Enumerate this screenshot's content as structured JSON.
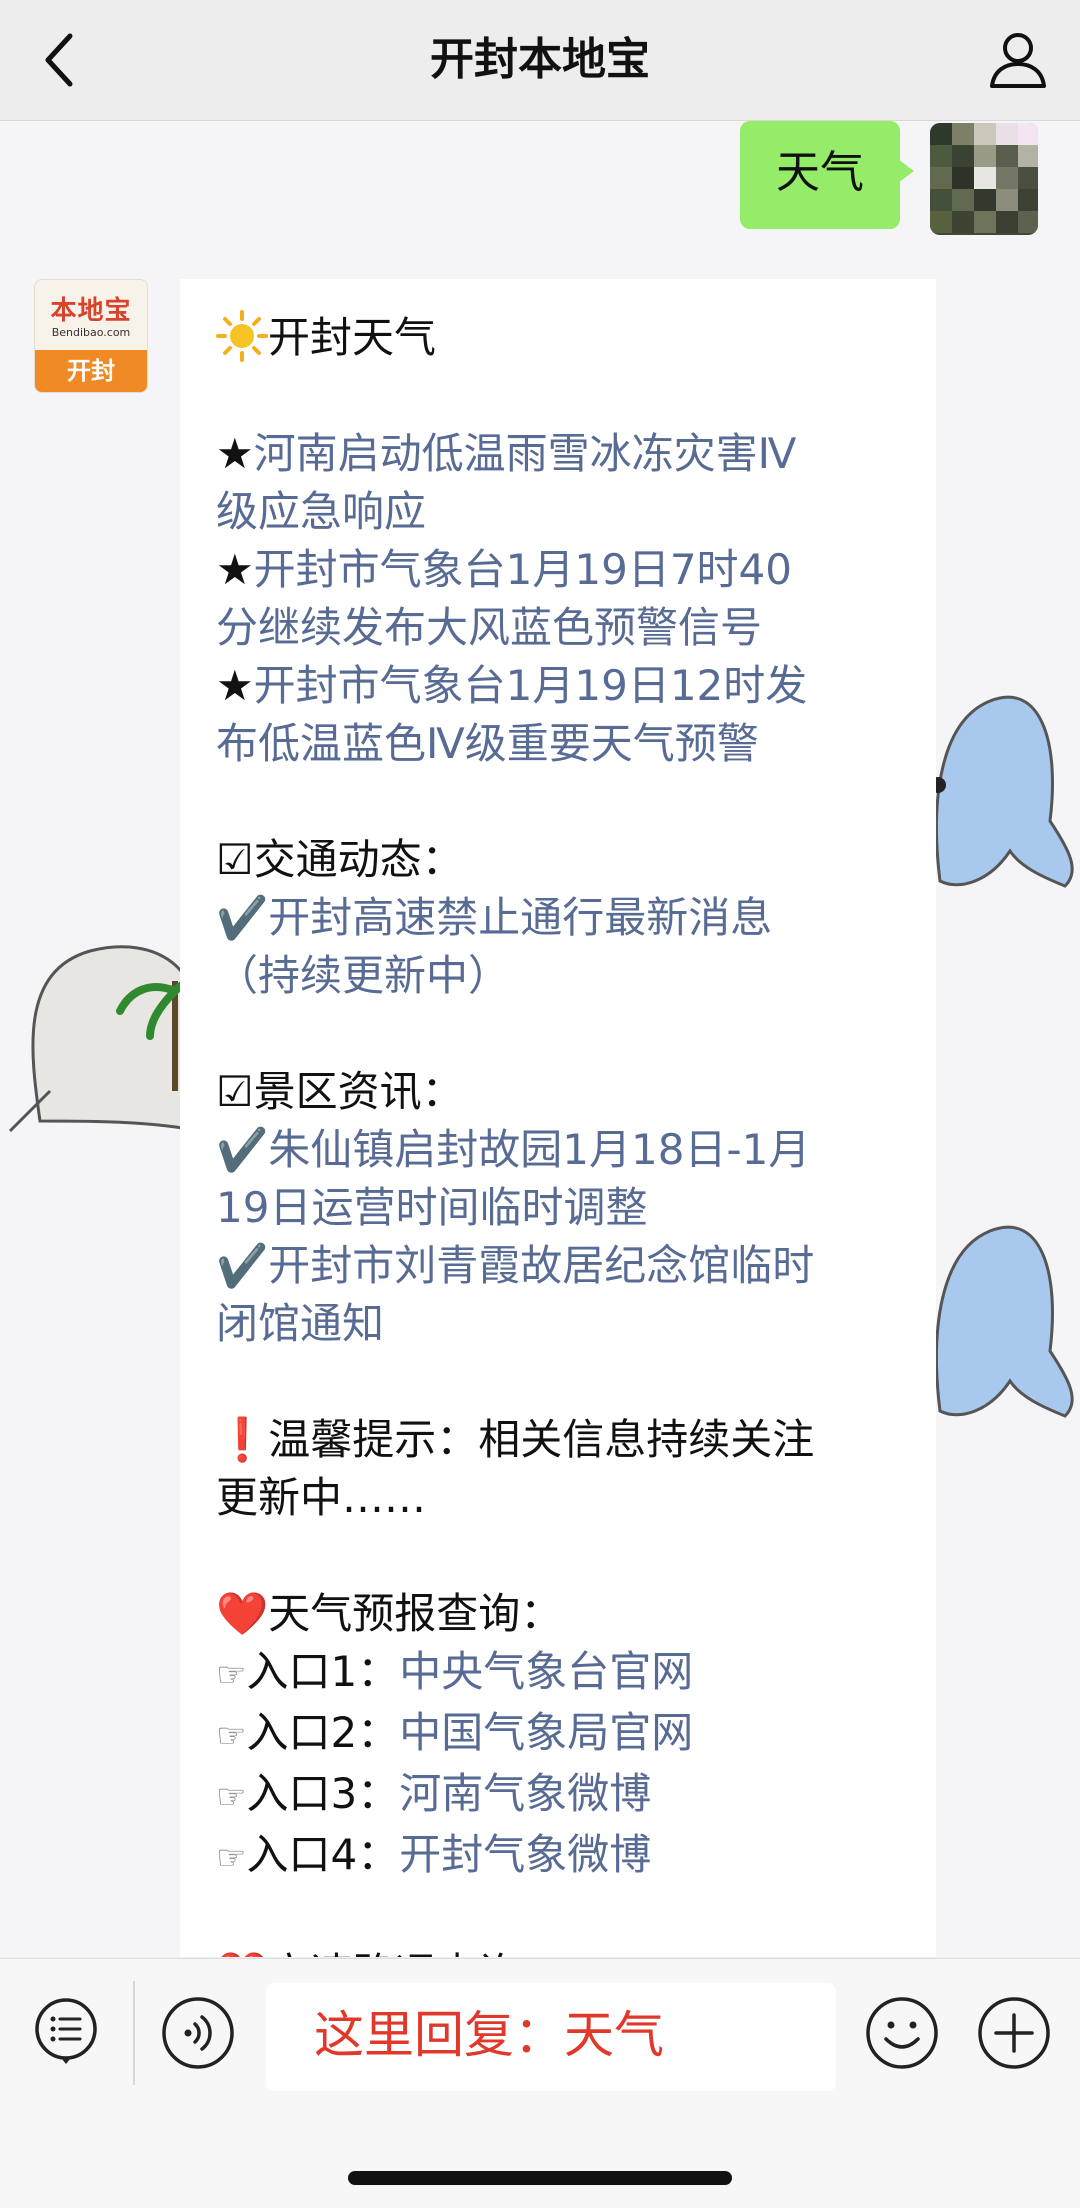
{
  "header": {
    "title": "开封本地宝",
    "back_icon": "chevron-left-icon",
    "profile_icon": "person-icon"
  },
  "chat": {
    "user_message": "天气",
    "bot_avatar": {
      "logo_text": "本地宝",
      "logo_url": "Bendibao.com",
      "city": "开封"
    },
    "bot_message": {
      "title": "开封天气",
      "news": [
        {
          "prefix": "★",
          "text": "河南启动低温雨雪冰冻灾害Ⅳ",
          "text2": "级应急响应"
        },
        {
          "prefix": "★",
          "text": "开封市气象台1月19日7时40",
          "text2": "分继续发布大风蓝色预警信号"
        },
        {
          "prefix": "★",
          "text": "开封市气象台1月19日12时发",
          "text2": "布低温蓝色Ⅳ级重要天气预警"
        }
      ],
      "traffic_heading": "☑交通动态：",
      "traffic_items": [
        {
          "prefix": "✔️",
          "text": "开封高速禁止通行最新消息",
          "text2": "（持续更新中）"
        }
      ],
      "scenic_heading": "☑景区资讯：",
      "scenic_items": [
        {
          "prefix": "✔️",
          "text": "朱仙镇启封故园1月18日-1月",
          "text2": "19日运营时间临时调整"
        },
        {
          "prefix": "✔️",
          "text": "开封市刘青霞故居纪念馆临时",
          "text2": "闭馆通知"
        }
      ],
      "tip_prefix": "❗",
      "tip_line1": "温馨提示：相关信息持续关注",
      "tip_line2": "更新中……",
      "forecast_prefix": "❤️",
      "forecast_heading": "天气预报查询：",
      "forecast_items": [
        {
          "label": "入口1：",
          "link": "中央气象台官网"
        },
        {
          "label": "入口2：",
          "link": "中国气象局官网"
        },
        {
          "label": "入口3：",
          "link": "河南气象微博"
        },
        {
          "label": "入口4：",
          "link": "开封气象微博"
        }
      ],
      "hand_glyph": "☞",
      "next_heading": "高速路况查询"
    }
  },
  "bottom_bar": {
    "input_text": "这里回复：天气",
    "icons": [
      "menu-list-icon",
      "voice-icon",
      "emoji-icon",
      "plus-icon"
    ]
  },
  "colors": {
    "link": "#576b95",
    "user_bubble": "#95ec69",
    "input_text": "#e0392b"
  }
}
